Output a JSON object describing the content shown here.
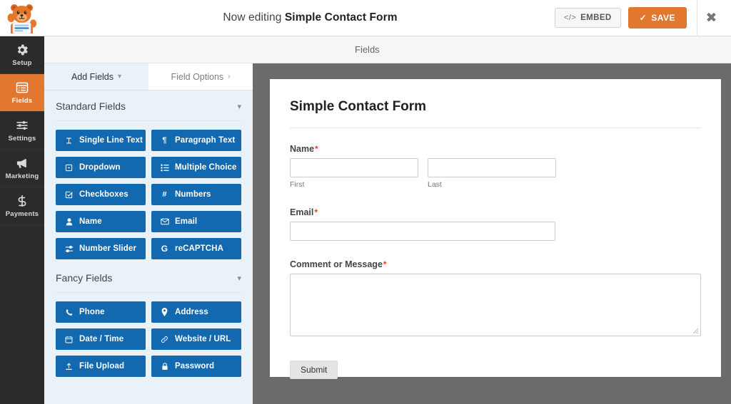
{
  "topbar": {
    "logo_alt": "wpforms-mascot-logo",
    "editing_prefix": "Now editing",
    "form_name": "Simple Contact Form",
    "embed_label": "EMBED",
    "embed_icon": "code-icon",
    "save_label": "SAVE",
    "save_icon": "check-icon",
    "close_icon": "close-icon",
    "accent_orange": "#e27730"
  },
  "rail": {
    "items": [
      {
        "label": "Setup",
        "icon": "gear-icon",
        "active": false
      },
      {
        "label": "Fields",
        "icon": "list-icon",
        "active": true
      },
      {
        "label": "Settings",
        "icon": "sliders-icon",
        "active": false
      },
      {
        "label": "Marketing",
        "icon": "megaphone-icon",
        "active": false
      },
      {
        "label": "Payments",
        "icon": "dollar-icon",
        "active": false
      }
    ]
  },
  "panel_strip": {
    "label": "Fields"
  },
  "fields_panel": {
    "tabs": [
      {
        "label": "Add Fields",
        "chevron": "chevron-down-icon",
        "active": true
      },
      {
        "label": "Field Options",
        "chevron": "chevron-right-icon",
        "active": false
      }
    ],
    "sections": [
      {
        "title": "Standard Fields",
        "chevron": "chevron-down-icon",
        "fields": [
          {
            "label": "Single Line Text",
            "icon": "text-cursor-icon"
          },
          {
            "label": "Paragraph Text",
            "icon": "pilcrow-icon"
          },
          {
            "label": "Dropdown",
            "icon": "dropdown-icon"
          },
          {
            "label": "Multiple Choice",
            "icon": "radio-list-icon"
          },
          {
            "label": "Checkboxes",
            "icon": "checkbox-icon"
          },
          {
            "label": "Numbers",
            "icon": "hash-icon"
          },
          {
            "label": "Name",
            "icon": "user-icon"
          },
          {
            "label": "Email",
            "icon": "envelope-icon"
          },
          {
            "label": "Number Slider",
            "icon": "slider-icon"
          },
          {
            "label": "reCAPTCHA",
            "icon": "google-g-icon"
          }
        ]
      },
      {
        "title": "Fancy Fields",
        "chevron": "chevron-down-icon",
        "fields": [
          {
            "label": "Phone",
            "icon": "phone-icon"
          },
          {
            "label": "Address",
            "icon": "map-pin-icon"
          },
          {
            "label": "Date / Time",
            "icon": "calendar-icon"
          },
          {
            "label": "Website / URL",
            "icon": "link-icon"
          },
          {
            "label": "File Upload",
            "icon": "upload-icon"
          },
          {
            "label": "Password",
            "icon": "lock-icon"
          }
        ]
      }
    ],
    "field_button_color": "#1269b0"
  },
  "form_preview": {
    "title": "Simple Contact Form",
    "required_marker": "*",
    "fields": [
      {
        "label": "Name",
        "required": true,
        "type": "name-split",
        "sublabels": [
          "First",
          "Last"
        ],
        "values": [
          "",
          ""
        ]
      },
      {
        "label": "Email",
        "required": true,
        "type": "text",
        "value": ""
      },
      {
        "label": "Comment or Message",
        "required": true,
        "type": "textarea",
        "value": ""
      }
    ],
    "submit_label": "Submit"
  }
}
